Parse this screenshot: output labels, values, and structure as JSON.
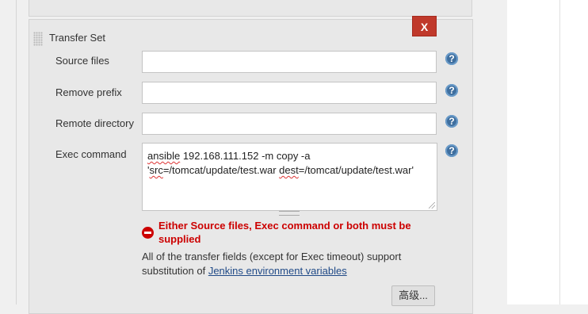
{
  "panel": {
    "title": "Transfer Set",
    "delete_label": "X"
  },
  "fields": {
    "source_files": {
      "label": "Source files",
      "value": ""
    },
    "remove_prefix": {
      "label": "Remove prefix",
      "value": ""
    },
    "remote_directory": {
      "label": "Remote directory",
      "value": ""
    },
    "exec_command": {
      "label": "Exec command",
      "value_line1_part1": "ansible",
      "value_line1_part2": " 192.168.111.152 -m copy -a",
      "value_line2_part1": "'",
      "value_line2_part2": "src",
      "value_line2_part3": "=/tomcat/update/test.war ",
      "value_line2_part4": "dest",
      "value_line2_part5": "=/tomcat/update/test.war'"
    }
  },
  "help_icon": "?",
  "error": {
    "line1": "Either Source files, Exec command or both must be",
    "line2": "supplied"
  },
  "info": {
    "text_part1": "All of the transfer fields (except for Exec timeout) support",
    "text_part2": "substitution of ",
    "link_text": "Jenkins environment variables"
  },
  "advanced_button": "高级..."
}
